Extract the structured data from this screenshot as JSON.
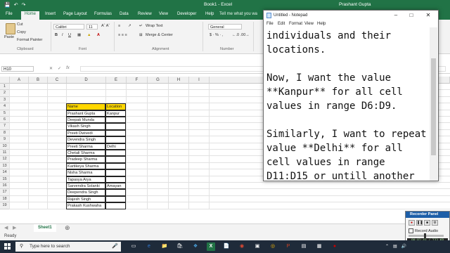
{
  "colors": {
    "excel_green": "#217346",
    "selection_yellow": "#ffd700",
    "taskbar": "#1f2b3a",
    "recorder_title": "#1e5fa8"
  },
  "excel": {
    "title": "Book1 - Excel",
    "user": "Prashant Gupta",
    "tabs": [
      "File",
      "Home",
      "Insert",
      "Page Layout",
      "Formulas",
      "Data",
      "Review",
      "View",
      "Developer",
      "Help"
    ],
    "active_tab": "Home",
    "tellme": "Tell me what you wa",
    "ribbon": {
      "cut": "Cut",
      "copy": "Copy",
      "format_painter": "Format Painter",
      "paste": "Paste",
      "font_name": "Calibri",
      "font_size": "11",
      "wrap_text": "Wrap Text",
      "merge_center": "Merge & Center",
      "number_format": "General",
      "groups": [
        "Clipboard",
        "Font",
        "Alignment",
        "Number"
      ]
    },
    "name_box": "H10",
    "columns": [
      "A",
      "B",
      "C",
      "D",
      "E",
      "F",
      "G",
      "H",
      "I"
    ],
    "rows": [
      "1",
      "2",
      "3",
      "4",
      "5",
      "6",
      "7",
      "8",
      "9",
      "10",
      "11",
      "12",
      "13",
      "14",
      "15",
      "16",
      "17",
      "18",
      "19"
    ],
    "table": {
      "header": {
        "name": "Name",
        "location": "Location"
      },
      "entries": [
        {
          "row": "5",
          "name": "Prashant Gupta",
          "location": "Kanpur"
        },
        {
          "row": "6",
          "name": "Deepak Munda",
          "location": ""
        },
        {
          "row": "7",
          "name": "Vikash Singh",
          "location": ""
        },
        {
          "row": "8",
          "name": "Preeti Dwivedi",
          "location": ""
        },
        {
          "row": "9",
          "name": "Devendra Singh",
          "location": ""
        },
        {
          "row": "10",
          "name": "Preeti Sharma",
          "location": "Delhi"
        },
        {
          "row": "11",
          "name": "Chetali Sharma",
          "location": ""
        },
        {
          "row": "12",
          "name": "Pradeep Sharma",
          "location": ""
        },
        {
          "row": "13",
          "name": "Kartikeya Sharma",
          "location": ""
        },
        {
          "row": "14",
          "name": "Nisha Sharma",
          "location": ""
        },
        {
          "row": "15",
          "name": "Tapasya Arya",
          "location": ""
        },
        {
          "row": "16",
          "name": "Sarvendra Solanki",
          "location": "Amayan"
        },
        {
          "row": "17",
          "name": "Deependra Singh",
          "location": ""
        },
        {
          "row": "18",
          "name": "Rajesh Singh",
          "location": ""
        },
        {
          "row": "19",
          "name": "Prakash Kushwaha",
          "location": ""
        }
      ]
    },
    "sheet_tab": "Sheet1",
    "status": "Ready"
  },
  "notepad": {
    "title": "Untitled - Notepad",
    "menu": [
      "File",
      "Edit",
      "Format",
      "View",
      "Help"
    ],
    "text": "individuals and their\nlocations.\n\nNow, I want the value\n**Kanpur** for all cell\nvalues in range D6:D9.\n\nSimilarly, I want to repeat\nvalue **Delhi** for all\ncell values in range\nD11:D15 or untill another\nvalue that is **Ama"
  },
  "recorder": {
    "title": "Recorder Panel",
    "record_audio": "Record Audio",
    "time": "00:01:43 / 233 KB"
  },
  "taskbar": {
    "search_placeholder": "Type here to search"
  }
}
